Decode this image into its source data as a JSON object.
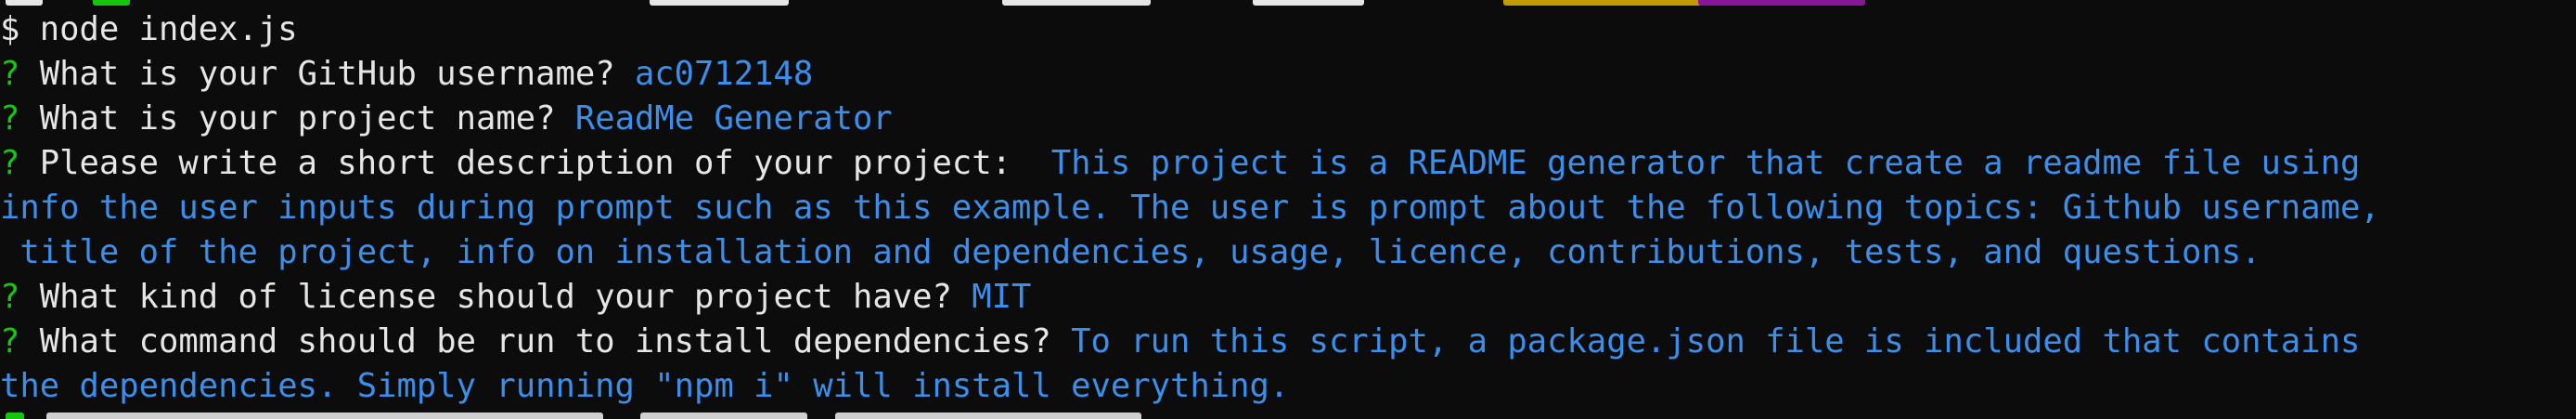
{
  "terminal": {
    "shell_prompt_symbol": "$",
    "command": "node index.js",
    "prompts": [
      {
        "marker": "?",
        "question": "What is your GitHub username?",
        "answer_lines": [
          "ac0712148"
        ]
      },
      {
        "marker": "?",
        "question": "What is your project name?",
        "answer_lines": [
          "ReadMe Generator"
        ]
      },
      {
        "marker": "?",
        "question": "Please write a short description of your project: ",
        "answer_lines": [
          "This project is a README generator that create a readme file using",
          "info the user inputs during prompt such as this example. The user is prompt about the following topics: Github username,",
          " title of the project, info on installation and dependencies, usage, licence, contributions, tests, and questions."
        ]
      },
      {
        "marker": "?",
        "question": "What kind of license should your project have?",
        "answer_lines": [
          "MIT"
        ]
      },
      {
        "marker": "?",
        "question": "What command should be run to install dependencies?",
        "answer_lines": [
          "To run this script, a package.json file is included that contains",
          "the dependencies. Simply running \"npm i\" will install everything."
        ]
      }
    ]
  },
  "colors": {
    "background": "#0c0c0c",
    "text": "#e6e6e6",
    "question_marker": "#16c60c",
    "answer": "#3b8eea"
  }
}
